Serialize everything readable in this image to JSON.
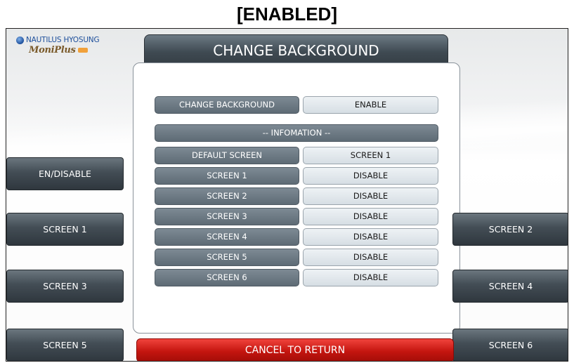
{
  "caption": "[ENABLED]",
  "brand": {
    "company": "NAUTILUS HYOSUNG",
    "product": "MoniPlus",
    "icon": "globe-icon"
  },
  "title": "CHANGE BACKGROUND",
  "settings": {
    "rows": [
      {
        "label": "CHANGE BACKGROUND",
        "value": "ENABLE"
      }
    ],
    "info_header": "-- INFOMATION --",
    "info_rows": [
      {
        "label": "DEFAULT SCREEN",
        "value": "SCREEN 1"
      },
      {
        "label": "SCREEN 1",
        "value": "DISABLE"
      },
      {
        "label": "SCREEN 2",
        "value": "DISABLE"
      },
      {
        "label": "SCREEN 3",
        "value": "DISABLE"
      },
      {
        "label": "SCREEN 4",
        "value": "DISABLE"
      },
      {
        "label": "SCREEN 5",
        "value": "DISABLE"
      },
      {
        "label": "SCREEN 6",
        "value": "DISABLE"
      }
    ]
  },
  "buttons": {
    "left": [
      "EN/DISABLE",
      "SCREEN 1",
      "SCREEN 3",
      "SCREEN 5"
    ],
    "right": [
      "SCREEN 2",
      "SCREEN 4",
      "SCREEN 6"
    ],
    "cancel": "CANCEL TO RETURN"
  },
  "colors": {
    "title_bar": "#3f4a52",
    "label_cell": "#6b7882",
    "value_cell": "#dfe6eb",
    "cancel": "#d11a14"
  }
}
